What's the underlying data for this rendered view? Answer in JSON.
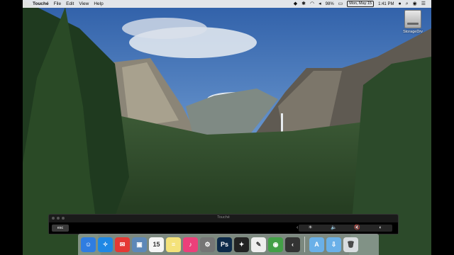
{
  "menubar": {
    "apple": "",
    "app_name": "Touché",
    "menus": [
      "File",
      "Edit",
      "View",
      "Help"
    ],
    "battery": "98%",
    "date": "Mon, May 15",
    "time": "1:41 PM"
  },
  "desktop": {
    "drive_label": "StorageDrv"
  },
  "touche_window": {
    "title": "Touché",
    "esc_label": "esc",
    "chevron": "‹",
    "controls": [
      "☀",
      "🔈",
      "🔇",
      "◐"
    ]
  },
  "dock": {
    "apps": [
      {
        "name": "finder-icon",
        "glyph": "☺",
        "color": "#2f7de1"
      },
      {
        "name": "safari-icon",
        "glyph": "✧",
        "color": "#1e88e5"
      },
      {
        "name": "mail-icon",
        "glyph": "✉",
        "color": "#e53935"
      },
      {
        "name": "preview-icon",
        "glyph": "▣",
        "color": "#5d88b8"
      },
      {
        "name": "calendar-icon",
        "glyph": "15",
        "color": "#f5f5f5"
      },
      {
        "name": "notes-icon",
        "glyph": "≡",
        "color": "#f4e27a"
      },
      {
        "name": "itunes-icon",
        "glyph": "♪",
        "color": "#ec407a"
      },
      {
        "name": "system-preferences-icon",
        "glyph": "⚙",
        "color": "#757575"
      },
      {
        "name": "photoshop-icon",
        "glyph": "Ps",
        "color": "#0d2a4a"
      },
      {
        "name": "final-cut-icon",
        "glyph": "✦",
        "color": "#222"
      },
      {
        "name": "grapher-icon",
        "glyph": "✎",
        "color": "#eeeeee"
      },
      {
        "name": "chrome-icon",
        "glyph": "◉",
        "color": "#43a047"
      },
      {
        "name": "touche-icon",
        "glyph": "‹",
        "color": "#333"
      }
    ],
    "stacks": [
      {
        "name": "applications-folder-icon",
        "glyph": "A",
        "color": "#6ab0e8"
      },
      {
        "name": "downloads-folder-icon",
        "glyph": "⇩",
        "color": "#6ab0e8"
      },
      {
        "name": "trash-icon",
        "glyph": "🗑",
        "color": "#d9dde0"
      }
    ]
  }
}
